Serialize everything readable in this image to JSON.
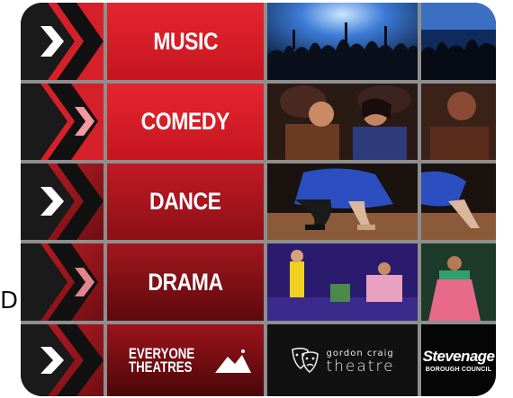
{
  "side_text": "D",
  "categories": [
    {
      "label": "MUSIC",
      "chevron_style": "solid"
    },
    {
      "label": "COMEDY",
      "chevron_style": "faded"
    },
    {
      "label": "DANCE",
      "chevron_style": "solid"
    },
    {
      "label": "DRAMA",
      "chevron_style": "faded"
    }
  ],
  "photos": [
    {
      "subject": "concert crowd with raised hands"
    },
    {
      "subject": "laughing audience"
    },
    {
      "subject": "dancers on stage"
    },
    {
      "subject": "drama performers on stage"
    }
  ],
  "logos": {
    "everyone_theatres": {
      "line1": "EVERYONE",
      "line2": "THEATRES"
    },
    "gordon_craig": {
      "line1": "gordon craig",
      "line2": "theatre"
    },
    "stevenage": {
      "name": "Stevenage",
      "sub": "BOROUGH COUNCIL"
    }
  },
  "colors": {
    "brand_red": "#d5202a",
    "dark_red": "#6f0f14",
    "grid": "#8e8e8e"
  }
}
